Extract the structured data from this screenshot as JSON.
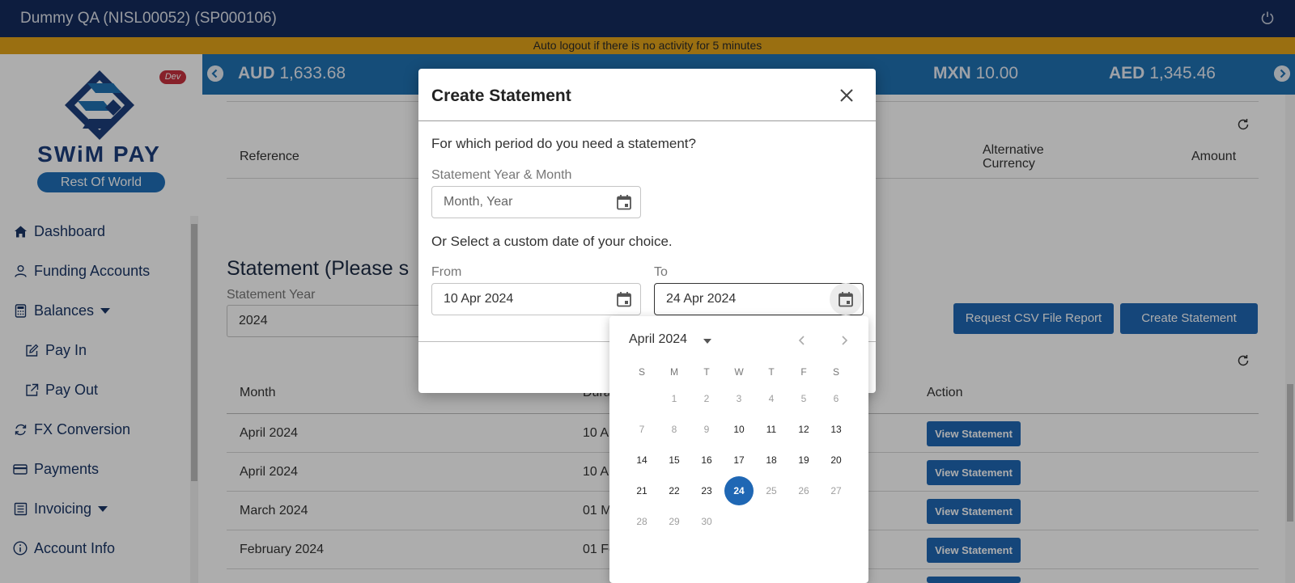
{
  "topbar": {
    "title": "Dummy QA (NISL00052) (SP000106)"
  },
  "warning": "Auto logout if there is no activity for 5 minutes",
  "sidebar": {
    "badge": "Dev",
    "brand": "SWiM PAY",
    "region": "Rest Of World",
    "items": [
      {
        "label": "Dashboard"
      },
      {
        "label": "Funding Accounts"
      },
      {
        "label": "Balances"
      },
      {
        "label": "Pay In"
      },
      {
        "label": "Pay Out"
      },
      {
        "label": "FX Conversion"
      },
      {
        "label": "Payments"
      },
      {
        "label": "Invoicing"
      },
      {
        "label": "Account Info"
      }
    ]
  },
  "ticker": [
    {
      "code": "AUD",
      "amount": "1,633.68"
    },
    {
      "code": "MXN",
      "amount": "10.00"
    },
    {
      "code": "AED",
      "amount": "1,345.46"
    }
  ],
  "main": {
    "table1_headers": {
      "reference": "Reference",
      "alt_currency": "Alternative Currency",
      "amount": "Amount"
    },
    "stmt_title": "Statement (Please s",
    "stmt_year_label": "Statement Year",
    "stmt_year_value": "2024",
    "csv_button": "Request CSV File Report",
    "create_button": "Create Statement",
    "table2_headers": {
      "month": "Month",
      "duration": "Dura",
      "action": "Action"
    },
    "rows": [
      {
        "month": "April 2024",
        "duration": "10 A",
        "action": "View Statement"
      },
      {
        "month": "April 2024",
        "duration": "10 A",
        "action": "View Statement"
      },
      {
        "month": "March 2024",
        "duration": "01 M",
        "action": "View Statement"
      },
      {
        "month": "February 2024",
        "duration": "01 Fe",
        "action": "View Statement"
      }
    ]
  },
  "dialog": {
    "title": "Create Statement",
    "question": "For which period do you need a statement?",
    "year_month_label": "Statement Year & Month",
    "year_month_placeholder": "Month, Year",
    "custom_text": "Or Select a custom date of your choice.",
    "from_label": "From",
    "from_value": "10 Apr 2024",
    "to_label": "To",
    "to_value": "24 Apr 2024"
  },
  "picker": {
    "month_label": "April 2024",
    "dow": [
      "S",
      "M",
      "T",
      "W",
      "T",
      "F",
      "S"
    ],
    "weeks": [
      [
        "",
        "1",
        "2",
        "3",
        "4",
        "5",
        "6"
      ],
      [
        "7",
        "8",
        "9",
        "10",
        "11",
        "12",
        "13"
      ],
      [
        "14",
        "15",
        "16",
        "17",
        "18",
        "19",
        "20"
      ],
      [
        "21",
        "22",
        "23",
        "24",
        "25",
        "26",
        "27"
      ],
      [
        "28",
        "29",
        "30",
        "",
        "",
        "",
        ""
      ]
    ],
    "selected_day": "24",
    "enabled_from": "10",
    "enabled_to": "24"
  },
  "colors": {
    "topbar": "#142c5e",
    "warning": "#e3a41a",
    "ticker": "#1f72b3",
    "primary_button": "#1f67b4",
    "brand_text": "#1d3e7c",
    "dev_badge": "#c8323e"
  }
}
